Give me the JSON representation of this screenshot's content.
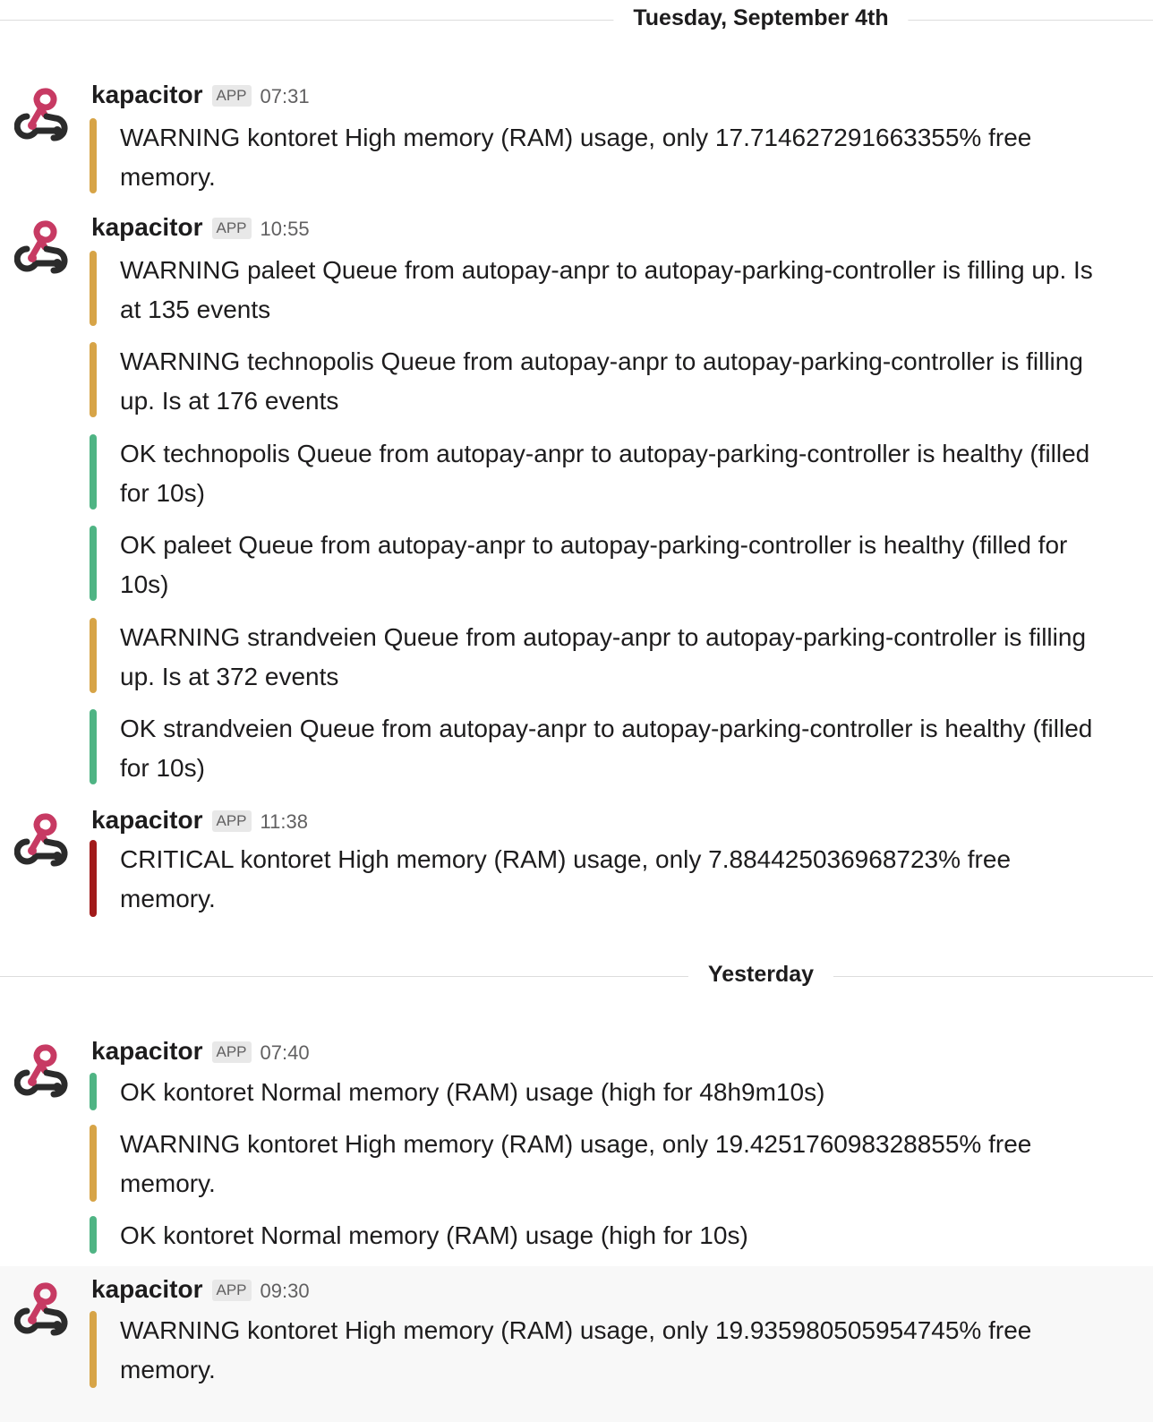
{
  "colors": {
    "warning": "#d7a447",
    "ok": "#4fb484",
    "critical": "#a11a1a",
    "avatar_pink": "#c73a63",
    "avatar_dark": "#2b2b2b"
  },
  "dividers": [
    {
      "label": "Tuesday, September 4th"
    },
    {
      "label": "Yesterday"
    }
  ],
  "messages": [
    {
      "sender": "kapacitor",
      "badge": "APP",
      "time": "07:31",
      "avatar_icon": "webhook-icon",
      "attachments": [
        {
          "level": "warning",
          "text": "WARNING kontoret High memory (RAM) usage, only 17.714627291663355% free memory."
        }
      ]
    },
    {
      "sender": "kapacitor",
      "badge": "APP",
      "time": "10:55",
      "avatar_icon": "webhook-icon",
      "attachments": [
        {
          "level": "warning",
          "text": "WARNING paleet Queue from autopay-anpr to autopay-parking-controller is filling up. Is at 135 events"
        },
        {
          "level": "warning",
          "text": "WARNING technopolis Queue from autopay-anpr to autopay-parking-controller is filling up. Is at 176 events"
        },
        {
          "level": "ok",
          "text": "OK technopolis Queue from autopay-anpr to autopay-parking-controller is healthy (filled for 10s)"
        },
        {
          "level": "ok",
          "text": "OK paleet Queue from autopay-anpr to autopay-parking-controller is healthy (filled for 10s)"
        },
        {
          "level": "warning",
          "text": "WARNING strandveien Queue from autopay-anpr to autopay-parking-controller is filling up. Is at 372 events"
        },
        {
          "level": "ok",
          "text": "OK strandveien Queue from autopay-anpr to autopay-parking-controller is healthy (filled for 10s)"
        }
      ]
    },
    {
      "sender": "kapacitor",
      "badge": "APP",
      "time": "11:38",
      "avatar_icon": "webhook-icon",
      "attachments": [
        {
          "level": "critical",
          "text": "CRITICAL kontoret High memory (RAM) usage, only 7.884425036968723% free memory."
        }
      ]
    },
    {
      "sender": "kapacitor",
      "badge": "APP",
      "time": "07:40",
      "avatar_icon": "webhook-icon",
      "attachments": [
        {
          "level": "ok",
          "text": "OK kontoret Normal memory (RAM) usage (high for 48h9m10s)"
        },
        {
          "level": "warning",
          "text": "WARNING kontoret High memory (RAM) usage, only 19.425176098328855% free memory."
        },
        {
          "level": "ok",
          "text": "OK kontoret Normal memory (RAM) usage (high for 10s)"
        }
      ]
    },
    {
      "sender": "kapacitor",
      "badge": "APP",
      "time": "09:30",
      "avatar_icon": "webhook-icon",
      "attachments": [
        {
          "level": "warning",
          "text": "WARNING kontoret High memory (RAM) usage, only 19.935980505954745% free memory."
        }
      ]
    }
  ]
}
